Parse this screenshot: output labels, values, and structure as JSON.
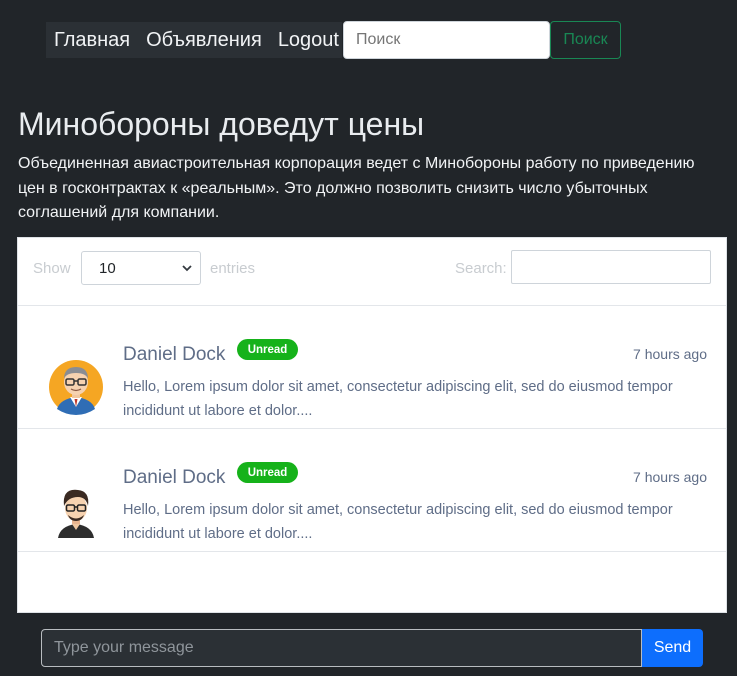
{
  "nav": {
    "items": [
      {
        "label": "Главная"
      },
      {
        "label": "Объявления"
      },
      {
        "label": "Logout"
      }
    ]
  },
  "search": {
    "placeholder": "Поиск",
    "button_label": "Поиск"
  },
  "article": {
    "title": "Минобороны доведут цены",
    "description": "Объединенная авиастроительная корпорация ведет с Минобороны работу по приведению цен в госконтрактах к «реальным». Это должно позволить снизить число убыточных соглашений для компании."
  },
  "table_controls": {
    "show_label": "Show",
    "length_value": "10",
    "entries_label": "entries",
    "search_label": "Search:",
    "search_value": ""
  },
  "messages": [
    {
      "sender": "Daniel Dock",
      "badge": "Unread",
      "time": "7 hours ago",
      "preview": "Hello, Lorem ipsum dolor sit amet, consectetur adipiscing elit, sed do eiusmod tempor incididunt ut labore et dolor....",
      "avatar": "man-with-glasses-avatar"
    },
    {
      "sender": "Daniel Dock",
      "badge": "Unread",
      "time": "7 hours ago",
      "preview": "Hello, Lorem ipsum dolor sit amet, consectetur adipiscing elit, sed do eiusmod tempor incididunt ut labore et dolor....",
      "avatar": "young-man-avatar"
    }
  ],
  "compose": {
    "placeholder": "Type your message",
    "send_label": "Send"
  },
  "colors": {
    "background": "#212529",
    "badge": "#16b21a",
    "primary": "#0d6efd",
    "success": "#198754"
  }
}
